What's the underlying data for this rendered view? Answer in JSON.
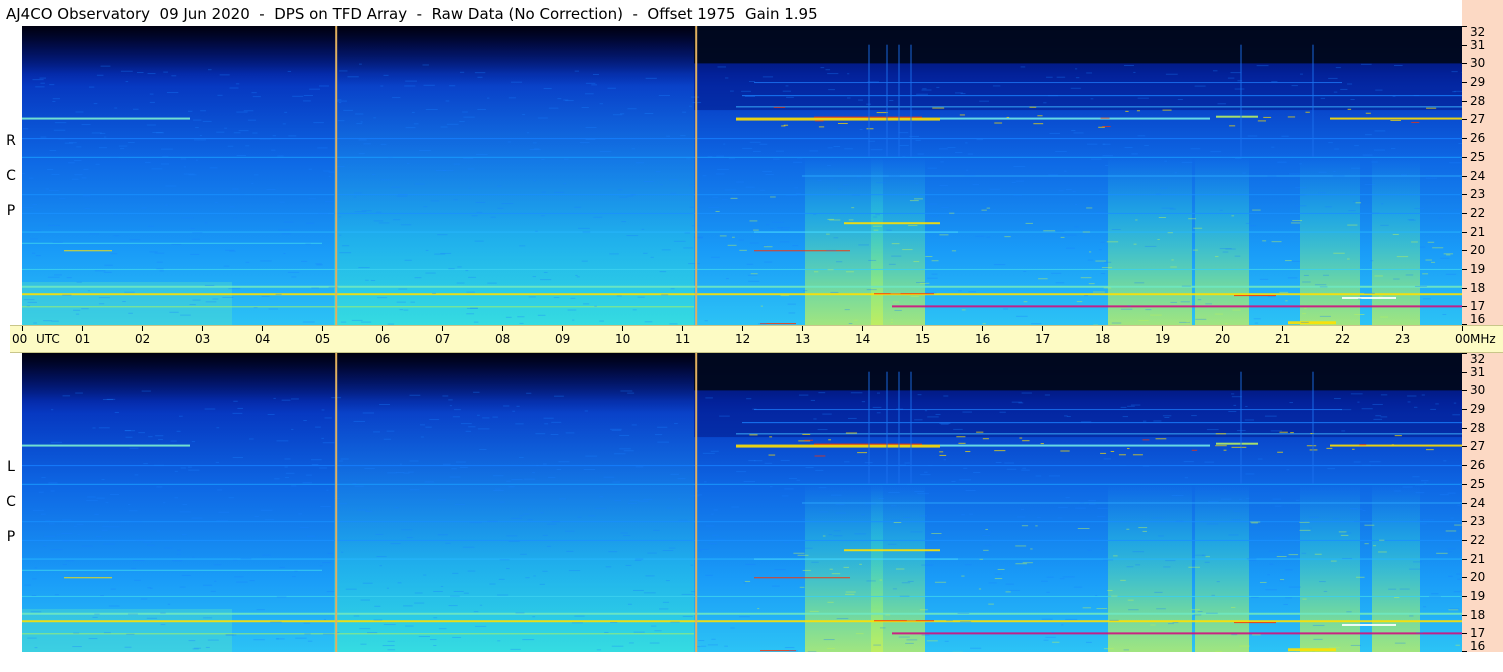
{
  "window": {
    "title": "AJ4CO Observatory  09 Jun 2020  -  DPS on TFD Array  -  Raw Data (No Correction)  -  Offset 1975  Gain 1.95"
  },
  "chart_data": {
    "type": "heatmap",
    "title": "AJ4CO Observatory  09 Jun 2020  -  DPS on TFD Array  -  Raw Data (No Correction)  -  Offset 1975  Gain 1.95",
    "x_axis": {
      "unit_label": "UTC",
      "range_hours": [
        0,
        24
      ],
      "tick_labels": [
        "00",
        "01",
        "02",
        "03",
        "04",
        "05",
        "06",
        "07",
        "08",
        "09",
        "10",
        "11",
        "12",
        "13",
        "14",
        "15",
        "16",
        "17",
        "18",
        "19",
        "20",
        "21",
        "22",
        "23",
        "00"
      ]
    },
    "y_axis": {
      "unit_label": "MHz",
      "range_mhz": [
        16,
        32
      ],
      "tick_labels": [
        "32",
        "31",
        "30",
        "29",
        "28",
        "27",
        "26",
        "25",
        "24",
        "23",
        "22",
        "21",
        "20",
        "19",
        "18",
        "17",
        "16"
      ]
    },
    "panels": [
      {
        "name": "RCP",
        "side_label": [
          "R",
          "C",
          "P"
        ]
      },
      {
        "name": "LCP",
        "side_label": [
          "L",
          "C",
          "P"
        ]
      }
    ],
    "markers_utc_hours": [
      5.22,
      11.22
    ],
    "colormap": [
      "#000010",
      "#001a6e",
      "#0a3fd8",
      "#1aa0ff",
      "#33e0e0",
      "#b8f060",
      "#ffe000",
      "#ff3000"
    ]
  }
}
